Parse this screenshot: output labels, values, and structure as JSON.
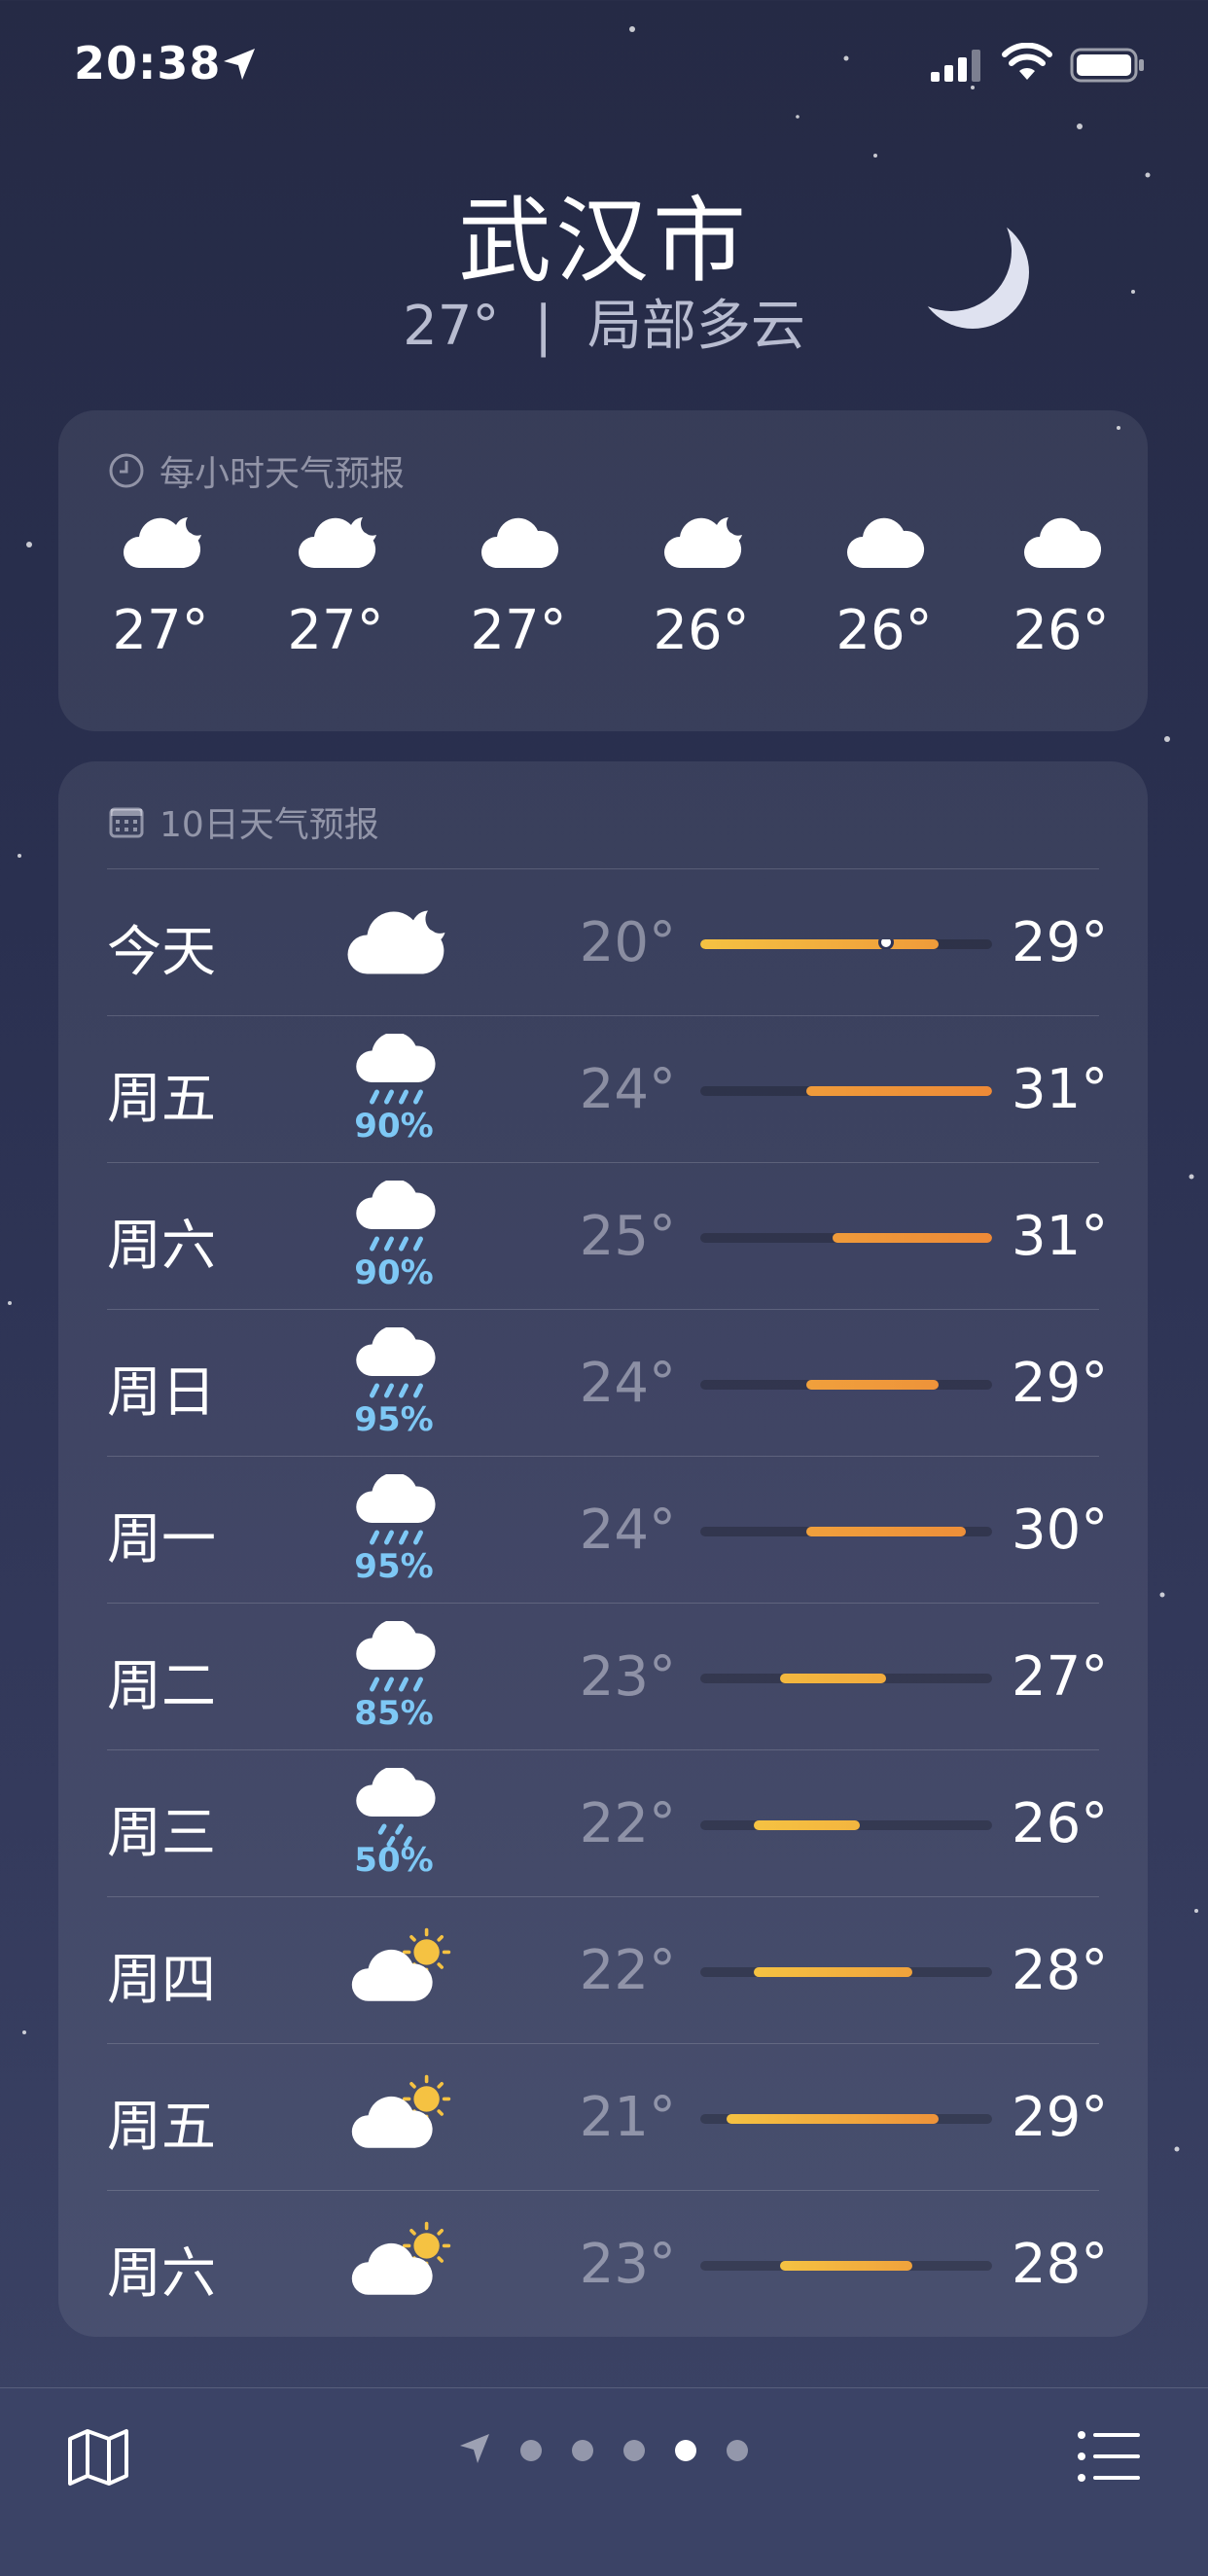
{
  "status_bar": {
    "time": "20:38"
  },
  "header": {
    "city": "武汉市",
    "temperature": "27°",
    "separator": "|",
    "condition": "局部多云"
  },
  "hourly": {
    "title": "每小时天气预报",
    "icon": "clock-icon",
    "items": [
      {
        "icon": "partly-cloudy-night",
        "temp": "27°"
      },
      {
        "icon": "partly-cloudy-night",
        "temp": "27°"
      },
      {
        "icon": "cloud",
        "temp": "27°"
      },
      {
        "icon": "partly-cloudy-night",
        "temp": "26°"
      },
      {
        "icon": "cloud",
        "temp": "26°"
      },
      {
        "icon": "cloud",
        "temp": "26°"
      }
    ]
  },
  "daily": {
    "title": "10日天气预报",
    "icon": "calendar-icon",
    "range_min": 20,
    "range_max": 31,
    "current_temp": 27,
    "rows": [
      {
        "day": "今天",
        "icon": "partly-cloudy-night",
        "precip": "",
        "low": "20°",
        "high": "29°",
        "low_val": 20,
        "high_val": 29,
        "colors": [
          "#f5c242",
          "#ef9b3a"
        ],
        "is_today": true
      },
      {
        "day": "周五",
        "icon": "cloud-rain",
        "precip": "90%",
        "low": "24°",
        "high": "31°",
        "low_val": 24,
        "high_val": 31,
        "colors": [
          "#ef9b3a",
          "#ee8a37"
        ]
      },
      {
        "day": "周六",
        "icon": "cloud-rain",
        "precip": "90%",
        "low": "25°",
        "high": "31°",
        "low_val": 25,
        "high_val": 31,
        "colors": [
          "#ef9b3a",
          "#ee8a37"
        ]
      },
      {
        "day": "周日",
        "icon": "cloud-rain",
        "precip": "95%",
        "low": "24°",
        "high": "29°",
        "low_val": 24,
        "high_val": 29,
        "colors": [
          "#f0a03c",
          "#ee933a"
        ]
      },
      {
        "day": "周一",
        "icon": "cloud-rain",
        "precip": "95%",
        "low": "24°",
        "high": "30°",
        "low_val": 24,
        "high_val": 30,
        "colors": [
          "#f0a03c",
          "#ee8f39"
        ]
      },
      {
        "day": "周二",
        "icon": "cloud-rain",
        "precip": "85%",
        "low": "23°",
        "high": "27°",
        "low_val": 23,
        "high_val": 27,
        "colors": [
          "#f3b83f",
          "#f2ab3d"
        ]
      },
      {
        "day": "周三",
        "icon": "cloud-drizzle",
        "precip": "50%",
        "low": "22°",
        "high": "26°",
        "low_val": 22,
        "high_val": 26,
        "colors": [
          "#f5c242",
          "#f3b53f"
        ]
      },
      {
        "day": "周四",
        "icon": "partly-sunny",
        "precip": "",
        "low": "22°",
        "high": "28°",
        "low_val": 22,
        "high_val": 28,
        "colors": [
          "#f5c242",
          "#f0a23c"
        ]
      },
      {
        "day": "周五",
        "icon": "partly-sunny",
        "precip": "",
        "low": "21°",
        "high": "29°",
        "low_val": 21,
        "high_val": 29,
        "colors": [
          "#f5c242",
          "#ee933a"
        ]
      },
      {
        "day": "周六",
        "icon": "partly-sunny",
        "precip": "",
        "low": "23°",
        "high": "28°",
        "low_val": 23,
        "high_val": 28,
        "colors": [
          "#f5c242",
          "#f0a23c"
        ]
      }
    ]
  },
  "tab_bar": {
    "left_icon": "map-icon",
    "right_icon": "list-icon",
    "page_count": 5,
    "active_page": 3
  },
  "colors": {
    "precip": "#7ec8f5",
    "sun": "#f5c242",
    "track": "#2d3356"
  }
}
